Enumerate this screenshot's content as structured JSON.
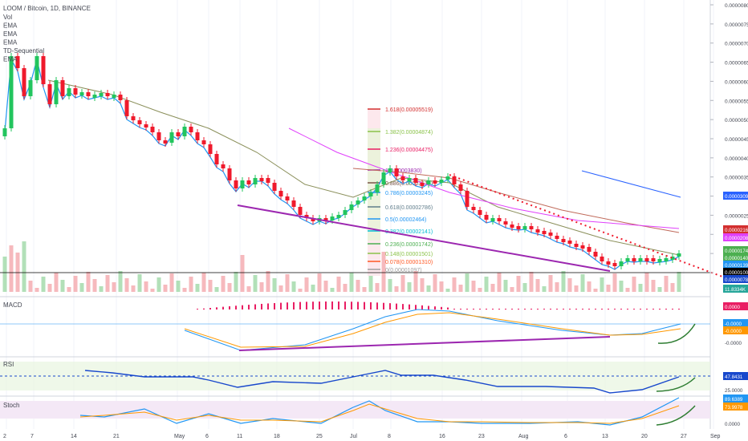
{
  "header": {
    "symbol_line": "LOOM / Bitcoin, 1D, BINANCE",
    "indicator_labels": [
      "Vol",
      "EMA",
      "EMA",
      "EMA",
      "TD-Sequential",
      "EMA"
    ]
  },
  "panes": {
    "macd": {
      "title": "MACD",
      "badges": [
        {
          "text": "0.0000",
          "color": "#e91e63"
        },
        {
          "text": "-0.0000",
          "color": "#2196f3"
        },
        {
          "text": "-0.0000",
          "color": "#ff9800"
        }
      ],
      "tick": "-0.0000"
    },
    "rsi": {
      "title": "RSI",
      "badge": {
        "text": "47.8431",
        "color": "#1848cc"
      },
      "tick": "25.0000"
    },
    "stoch": {
      "title": "Stoch",
      "badges": [
        {
          "text": "89.6389",
          "color": "#2196f3"
        },
        {
          "text": "73.9978",
          "color": "#ff9800"
        }
      ],
      "tick": "0.0000"
    }
  },
  "price_axis": {
    "ticks": [
      "0.00000800",
      "0.00000750",
      "0.00000700",
      "0.00000650",
      "0.00000600",
      "0.00000550",
      "0.00000500",
      "0.00000450",
      "0.00000400",
      "0.00000350",
      "0.00000300",
      "0.00000250",
      "0.00000200",
      "0.00000150",
      "0.00000100"
    ],
    "badges": [
      {
        "text": "0.00003092",
        "color": "#2962ff"
      },
      {
        "text": "0.00002165",
        "color": "#d32f2f"
      },
      {
        "text": "0.00002083",
        "color": "#e040fb"
      },
      {
        "text": "0.00001742",
        "color": "#4caf50"
      },
      {
        "text": "0.00001402",
        "color": "#4caf50"
      },
      {
        "text": "0.00001399",
        "color": "#2196f3"
      },
      {
        "text": "0.00001001",
        "color": "#000000"
      },
      {
        "text": "0.00000789",
        "color": "#1848cc"
      },
      {
        "text": "11.8334K",
        "color": "#26a69a"
      }
    ]
  },
  "time_axis": [
    "2",
    "7",
    "14",
    "21",
    "May",
    "6",
    "11",
    "18",
    "25",
    "Jul",
    "8",
    "16",
    "23",
    "Aug",
    "6",
    "13",
    "20",
    "27",
    "Sep"
  ],
  "fib_levels": [
    {
      "label": "1.618(0.00005519)",
      "color": "#d32f2f"
    },
    {
      "label": "1.382(0.00004874)",
      "color": "#8bc34a"
    },
    {
      "label": "1.236(0.00004475)",
      "color": "#e91e63"
    },
    {
      "label": "1(0.00003830)",
      "color": "#9c27b0"
    },
    {
      "label": "0.886(0.00003518)",
      "color": "#795548"
    },
    {
      "label": "0.786(0.00003245)",
      "color": "#2196f3"
    },
    {
      "label": "0.618(0.00002786)",
      "color": "#607d8b"
    },
    {
      "label": "0.5(0.00002464)",
      "color": "#2196f3"
    },
    {
      "label": "0.382(0.00002141)",
      "color": "#00bcd4"
    },
    {
      "label": "0.236(0.00001742)",
      "color": "#4caf50"
    },
    {
      "label": "0.148(0.00001501)",
      "color": "#8bc34a"
    },
    {
      "label": "0.078(0.00001310)",
      "color": "#ff5722"
    },
    {
      "label": "0(0.00001097)",
      "color": "#9e9e9e"
    }
  ],
  "colors": {
    "up": "#22c55e",
    "down": "#ef1a2c",
    "ema_blue": "#2196f3",
    "ema_olive": "#8a8f5a",
    "ema_brown": "#c06a5a",
    "ema_pink": "#e040fb",
    "trend_purple": "#9c27b0"
  },
  "chart_data": [
    {
      "type": "candlestick",
      "title": "LOOM / Bitcoin, 1D, BINANCE",
      "x_range": [
        "Apr 2",
        "Aug 27"
      ],
      "series": [
        {
          "values": [
            {
              "d": "Apr 2",
              "o": 7.5e-06,
              "c": 7.4e-06
            },
            {
              "d": "Apr 10",
              "o": 6.9e-06,
              "c": 6.6e-06
            },
            {
              "d": "Apr 21",
              "o": 6.2e-06,
              "c": 5.8e-06
            },
            {
              "d": "May 6",
              "o": 5.2e-06,
              "c": 4.8e-06
            },
            {
              "d": "May 18",
              "o": 3.8e-06,
              "c": 3.3e-06
            },
            {
              "d": "Jun 25",
              "o": 2.5e-06,
              "c": 2.4e-06
            },
            {
              "d": "Jul 8",
              "o": 3.5e-06,
              "c": 3.8e-06
            },
            {
              "d": "Jul 23",
              "o": 2.2e-06,
              "c": 2e-06
            },
            {
              "d": "Aug 13",
              "o": 1.1e-06,
              "c": 1e-06
            },
            {
              "d": "Aug 27",
              "o": 1.3e-06,
              "c": 1.4e-06
            }
          ]
        }
      ]
    },
    {
      "type": "line",
      "title": "MACD",
      "series": [
        {
          "name": "MACD",
          "values": []
        },
        {
          "name": "Signal",
          "values": []
        }
      ]
    },
    {
      "type": "line",
      "title": "RSI",
      "ylim": [
        25,
        75
      ],
      "series": [
        {
          "values": [
            72,
            65,
            55,
            40,
            30,
            45,
            60,
            48,
            35,
            28,
            47.8431
          ]
        }
      ]
    },
    {
      "type": "line",
      "title": "Stoch",
      "ylim": [
        0,
        100
      ],
      "series": [
        {
          "values": [
            30,
            80,
            20,
            60,
            15,
            90,
            10,
            70,
            20,
            89.6389
          ]
        },
        {
          "values": [
            35,
            70,
            25,
            55,
            20,
            80,
            15,
            60,
            25,
            73.9978
          ]
        }
      ]
    }
  ]
}
